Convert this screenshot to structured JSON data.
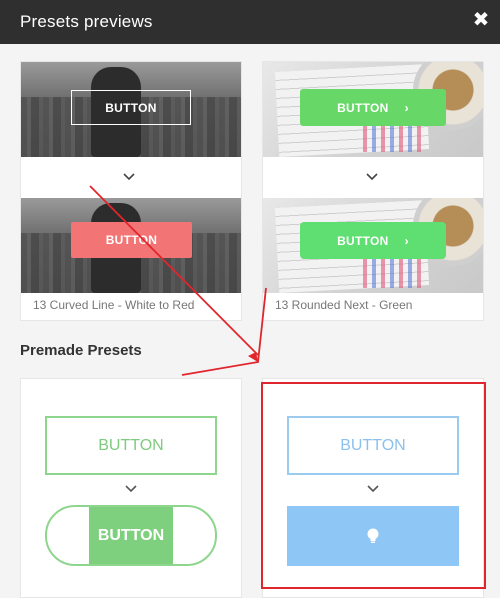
{
  "header": {
    "title": "Presets previews",
    "close_glyph": "✖"
  },
  "presets": [
    {
      "top_button_label": "BUTTON",
      "bottom_button_label": "BUTTON",
      "caption": "13 Curved Line - White to Red"
    },
    {
      "top_button_label": "BUTTON",
      "bottom_button_label": "BUTTON",
      "caption": "13 Rounded Next - Green",
      "chevron_glyph": "›"
    }
  ],
  "section": {
    "title": "Premade Presets"
  },
  "premade": [
    {
      "top_label": "BUTTON",
      "bottom_label": "BUTTON"
    },
    {
      "top_label": "BUTTON",
      "bottom_icon": "lightbulb-icon"
    }
  ],
  "colors": {
    "header_bg": "#2f2f2f",
    "red_button": "#f27474",
    "green_button": "#67d867",
    "outline_green": "#8ed68e",
    "outline_blue": "#9ccbf0",
    "fill_blue": "#8ec6f5",
    "annotation_red": "#e0262d"
  }
}
